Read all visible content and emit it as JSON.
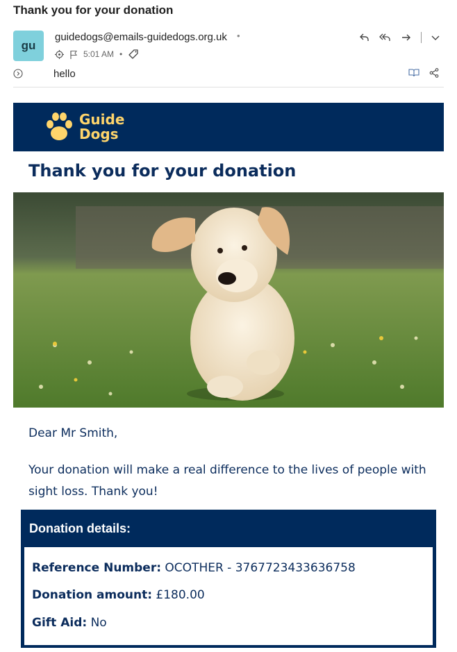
{
  "email": {
    "subject": "Thank you for your donation",
    "avatar_initials": "gu",
    "sender": "guidedogs@emails-guidedogs.org.uk",
    "time": "5:01 AM",
    "preview": "hello"
  },
  "icons": [
    "reply-icon",
    "reply-all-icon",
    "forward-icon",
    "chevron-down-icon",
    "expand-icon",
    "flag-icon",
    "target-icon",
    "tag-icon",
    "immersive-reader-icon",
    "share-icon"
  ],
  "content": {
    "logo_line1": "Guide",
    "logo_line2": "Dogs",
    "title": "Thank you for your donation",
    "greeting": "Dear Mr Smith,",
    "body": "Your donation will make a real difference to the lives of people with sight loss. Thank you!",
    "details": {
      "heading": "Donation details:",
      "reference_label": "Reference Number:",
      "reference_value": "OCOTHER - 3767723433636758",
      "amount_label": "Donation amount:",
      "amount_value": "£180.00",
      "giftaid_label": "Gift Aid:",
      "giftaid_value": "No"
    }
  },
  "colors": {
    "brand_navy": "#002a5c",
    "brand_yellow": "#ffd56b",
    "text_navy": "#0b2c5c",
    "avatar_bg": "#7fd0dc"
  }
}
